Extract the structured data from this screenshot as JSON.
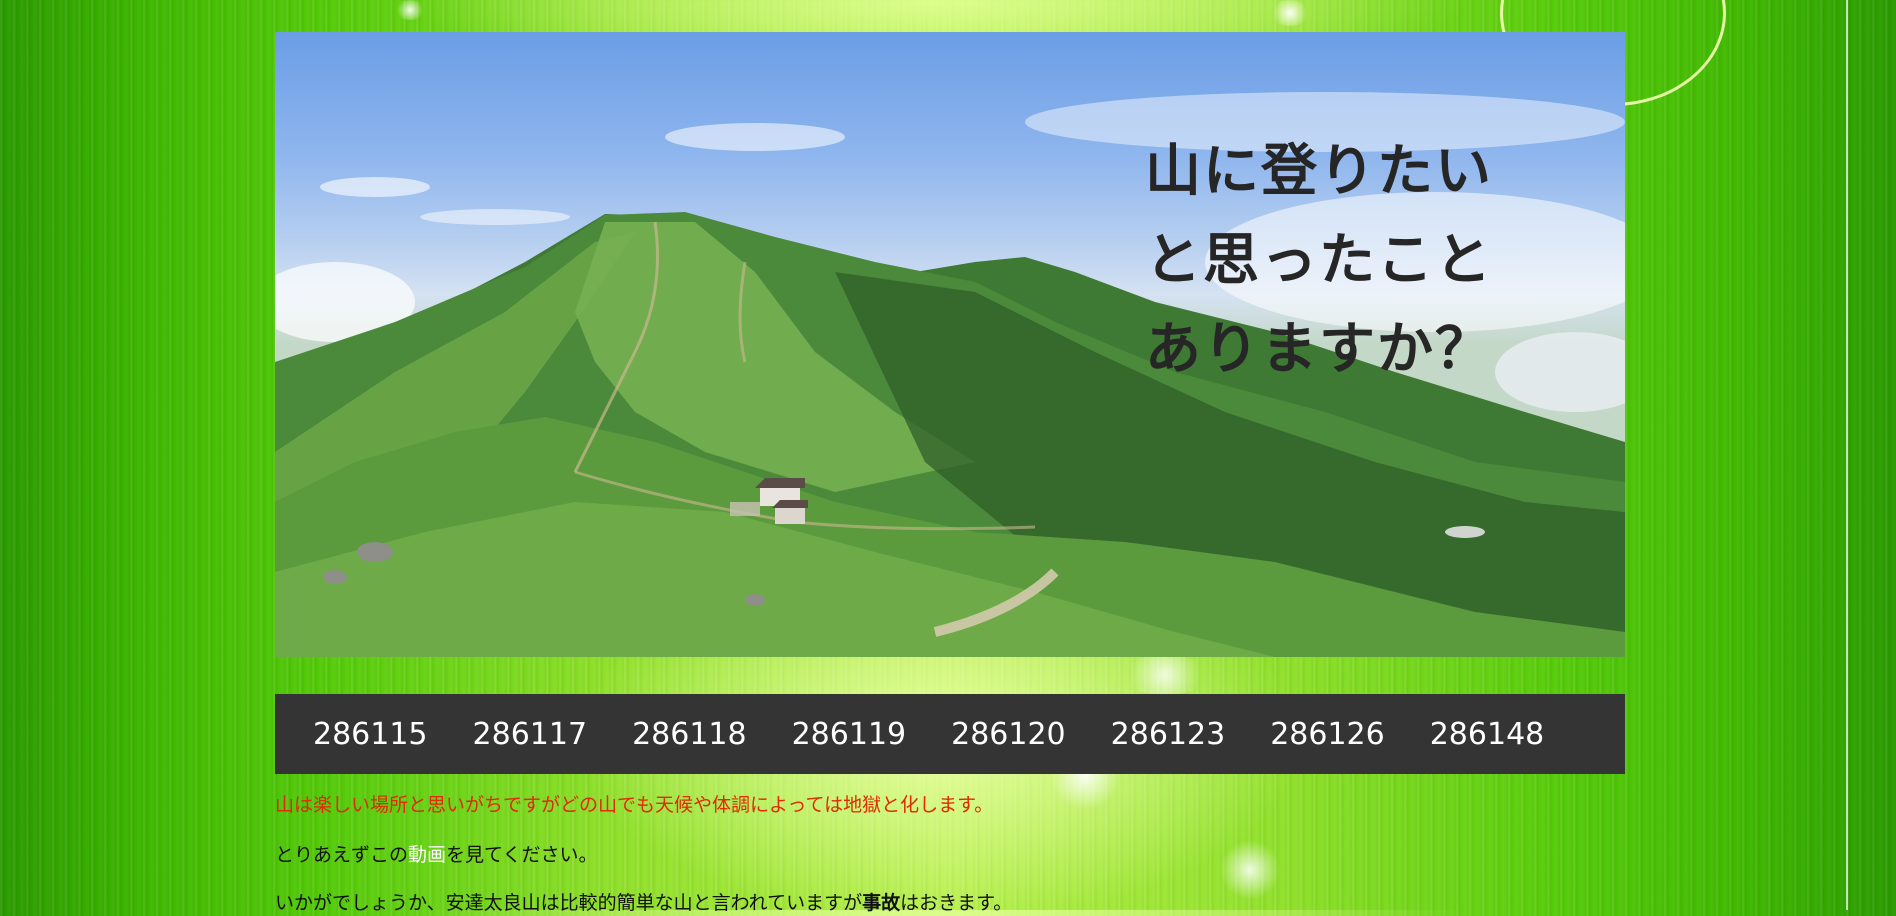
{
  "hero": {
    "title_lines": [
      "山に登りたい",
      "と思ったこと",
      "ありますか？"
    ]
  },
  "nav": {
    "items": [
      "286115",
      "286117",
      "286118",
      "286119",
      "286120",
      "286123",
      "286126",
      "286148"
    ]
  },
  "content": {
    "warning": "山は楽しい場所と思いがちですがどの山でも天候や体調によっては地獄と化します。",
    "p2_before": "とりあえずこの",
    "p2_link": "動画",
    "p2_after": "を見てください。",
    "p3_before": "いかがでしょうか、安達太良山は比較的簡単な山と言われていますが",
    "p3_bold": "事故",
    "p3_after": "はおきます。"
  },
  "colors": {
    "nav_bg": "#343434",
    "warning_text": "#e02a00",
    "background_green": "#56cc0a"
  }
}
